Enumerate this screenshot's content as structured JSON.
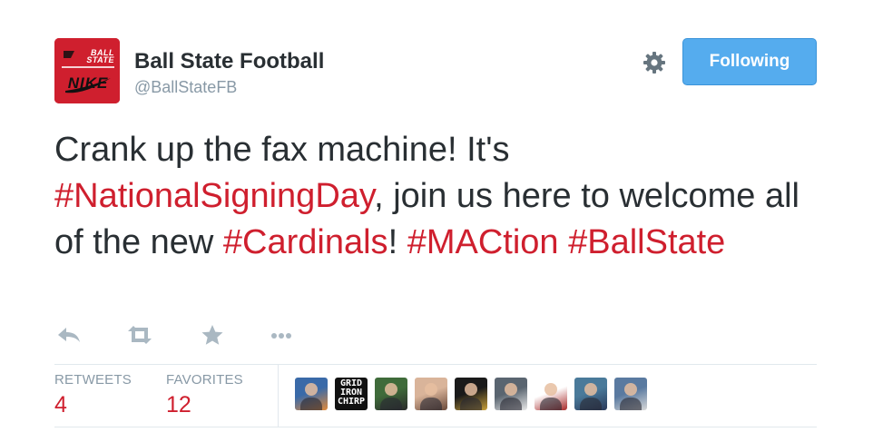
{
  "profile": {
    "display_name": "Ball State Football",
    "handle": "@BallStateFB",
    "avatar_text_top": "BALL STATE",
    "avatar_text_brand": "NIKE"
  },
  "follow_button": {
    "label": "Following"
  },
  "tweet": {
    "segments": [
      {
        "text": "Crank up the fax machine!  It's ",
        "type": "text"
      },
      {
        "text": "#NationalSigningDay",
        "type": "hashtag"
      },
      {
        "text": ", join us here to welcome all of the new ",
        "type": "text"
      },
      {
        "text": "#Cardinals",
        "type": "hashtag"
      },
      {
        "text": "! ",
        "type": "text"
      },
      {
        "text": "#MACtion",
        "type": "hashtag"
      },
      {
        "text": " ",
        "type": "text"
      },
      {
        "text": "#BallState",
        "type": "hashtag"
      }
    ]
  },
  "actions": [
    "reply-icon",
    "retweet-icon",
    "favorite-icon",
    "more-icon"
  ],
  "stats": {
    "retweets_label": "RETWEETS",
    "retweets_count": "4",
    "favorites_label": "FAVORITES",
    "favorites_count": "12"
  },
  "favoriters": [
    {
      "kind": "photo",
      "colors": [
        "#3a6aa8",
        "#e08a3c"
      ]
    },
    {
      "kind": "text",
      "text": "GRID\nIRON\nCHIRP",
      "colors": [
        "#111111",
        "#ffffff"
      ]
    },
    {
      "kind": "photo",
      "colors": [
        "#3f6b3a",
        "#2a2a2a"
      ]
    },
    {
      "kind": "photo",
      "colors": [
        "#d9b49a",
        "#6b4a3a"
      ]
    },
    {
      "kind": "photo",
      "colors": [
        "#1a1a1a",
        "#c8a03a"
      ]
    },
    {
      "kind": "photo",
      "colors": [
        "#5a6570",
        "#e8e8e8"
      ]
    },
    {
      "kind": "photo",
      "colors": [
        "#ffffff",
        "#a82a2a"
      ]
    },
    {
      "kind": "photo",
      "colors": [
        "#4a7a9a",
        "#2a3a5a"
      ]
    },
    {
      "kind": "photo",
      "colors": [
        "#5a7aa0",
        "#d8d8d8"
      ]
    }
  ],
  "colors": {
    "hashtag": "#cf1f2e",
    "count": "#cf1f2e",
    "follow_bg": "#55acee",
    "muted": "#8899a6"
  }
}
